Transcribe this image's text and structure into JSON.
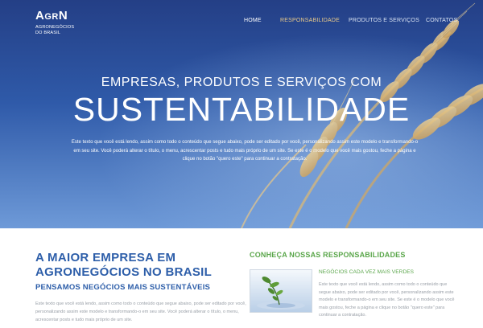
{
  "brand": {
    "logo_mark_big": "A",
    "logo_mark_small": "GR",
    "logo_mark_end": "N",
    "logo_sub_line1": "AGRONEGÓCIOS",
    "logo_sub_line2": "DO BRASIL"
  },
  "nav": [
    {
      "label": "HOME"
    },
    {
      "label": "RESPONSABILIDADE"
    },
    {
      "label": "PRODUTOS E SERVIÇOS"
    },
    {
      "label": "CONTATOS"
    }
  ],
  "hero": {
    "title_line1": "EMPRESAS, PRODUTOS E SERVIÇOS COM",
    "title_line2": "SUSTENTABILIDADE",
    "text": "Este texto que você está lendo, assim como todo o conteúdo que segue abaixo, pode ser editado por você, personalizando assim este modelo e transformando-o em seu site. Você poderá alterar o título, o menu, acrescentar posts e tudo mais próprio de um site. Se este é o modelo que você mais gostou, feche a página e clique no botão \"quero este\" para continuar a contratação."
  },
  "main": {
    "heading": "A MAIOR EMPRESA EM AGRONEGÓCIOS NO BRASIL",
    "subheading": "PENSAMOS NEGÓCIOS MAIS SUSTENTÁVEIS",
    "text": "Este texto que você está lendo, assim como todo o conteúdo que segue abaixo, pode ser editado por você, personalizando assim este modelo e transformando-o em seu site. Você poderá alterar o título, o menu, acrescentar posts e tudo mais próprio de um site."
  },
  "side": {
    "heading": "CONHEÇA NOSSAS RESPONSABILIDADES",
    "subheading": "NEGÓCIOS CADA VEZ MAIS VERDES",
    "text": "Este texto que você está lendo, assim como todo o conteúdo que segue abaixo, pode ser editado por você, personalizando assim este modelo e transformando-o em seu site. Se este é o modelo que você mais gostou, feche a página e clique no botão \"quero este\" para continuar a contratação."
  },
  "colors": {
    "accent_blue": "#2d5ea9",
    "accent_green": "#5aa64a",
    "body_text": "#9aa0a8"
  }
}
